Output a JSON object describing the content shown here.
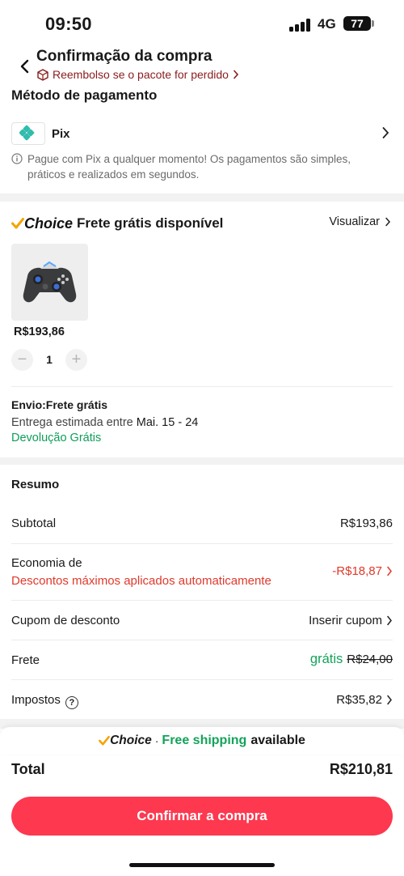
{
  "status_bar": {
    "time": "09:50",
    "network": "4G",
    "battery": "77"
  },
  "header": {
    "title": "Confirmação da compra",
    "refund_text": "Reembolso se o pacote for perdido"
  },
  "payment": {
    "section_title": "Método de pagamento",
    "method_label": "Pix",
    "info_text": "Pague com Pix a qualquer momento! Os pagamentos são simples, práticos e realizados em segundos."
  },
  "choice": {
    "brand": "Choice",
    "title": "Frete grátis disponível",
    "view_label": "Visualizar"
  },
  "product": {
    "price": "R$193,86",
    "quantity": "1"
  },
  "shipping": {
    "title": "Envio:Frete grátis",
    "eta_prefix": "Entrega estimada entre",
    "eta_dates": "Mai. 15 - 24",
    "return_label": "Devolução Grátis"
  },
  "summary": {
    "title": "Resumo",
    "subtotal_label": "Subtotal",
    "subtotal_value": "R$193,86",
    "savings_label": "Economia de",
    "savings_note": "Descontos máximos aplicados automaticamente",
    "savings_value": "-R$18,87",
    "coupon_label": "Cupom de desconto",
    "coupon_value": "Inserir cupom",
    "shipping_label": "Frete",
    "shipping_free": "grátis",
    "shipping_original": "R$24,00",
    "taxes_label": "Impostos",
    "taxes_value": "R$35,82"
  },
  "banner": {
    "brand": "Choice",
    "dot": "·",
    "free": "Free shipping",
    "available": "available"
  },
  "total": {
    "label": "Total",
    "value": "R$210,81"
  },
  "confirm_label": "Confirmar a compra",
  "colors": {
    "accent": "#fd384f",
    "green": "#13a35a",
    "red": "#e0392b",
    "refund": "#8a1c1c",
    "choice_check": "#f5a300"
  },
  "icons": [
    "back-arrow-icon",
    "box-icon",
    "pix-icon",
    "chevron-right-icon",
    "info-icon",
    "choice-check-icon",
    "help-icon"
  ]
}
